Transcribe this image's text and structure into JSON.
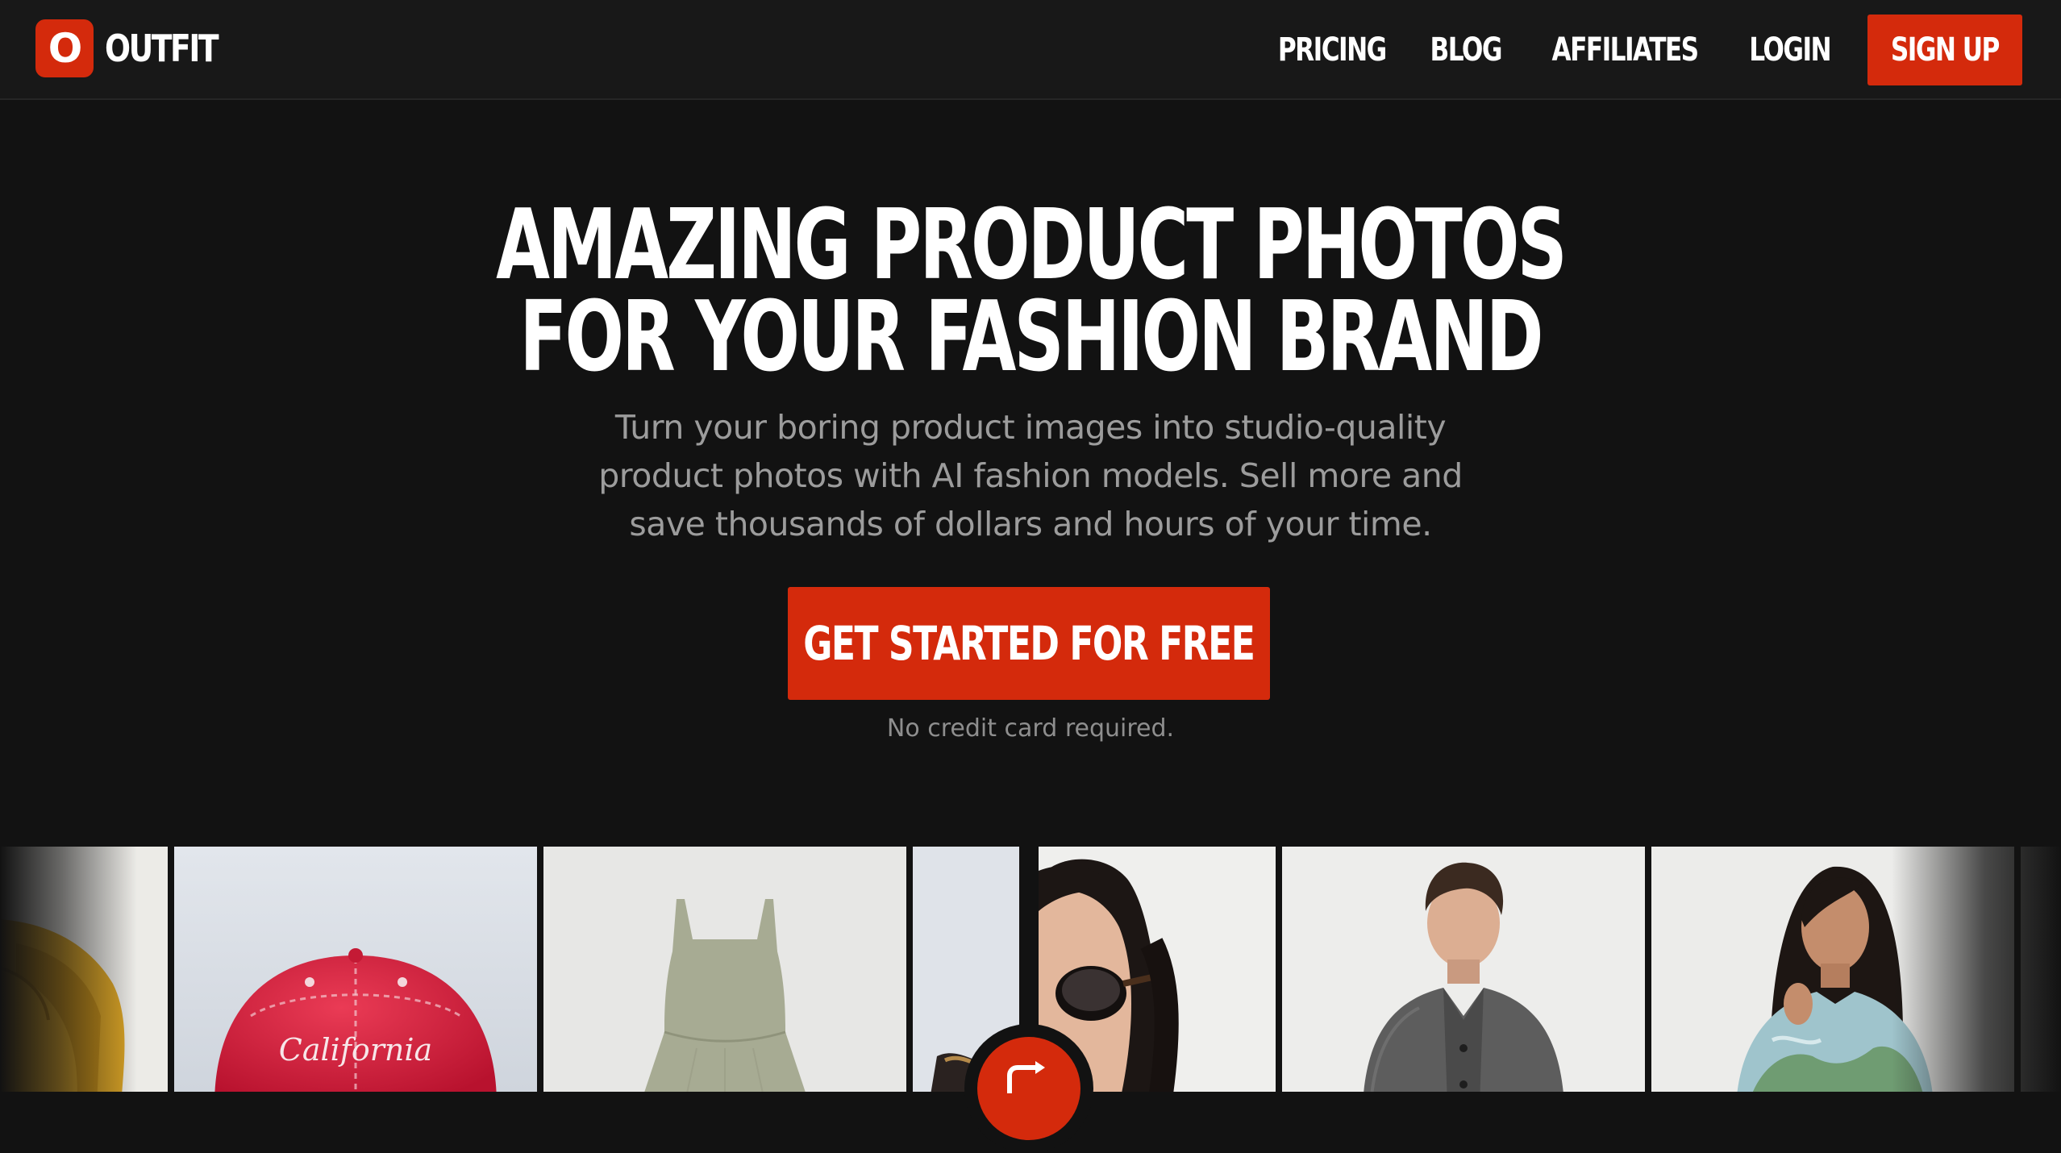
{
  "header": {
    "logo_mark": "O",
    "logo_text": "OUTFIT",
    "nav": [
      {
        "label": "PRICING"
      },
      {
        "label": "BLOG"
      },
      {
        "label": "AFFILIATES"
      },
      {
        "label": "LOGIN"
      }
    ],
    "signup_label": "SIGN UP"
  },
  "hero": {
    "title_line1": "AMAZING PRODUCT PHOTOS",
    "title_line2": "FOR YOUR FASHION BRAND",
    "subtitle_line1": "Turn your boring product images into studio-quality",
    "subtitle_line2": "product photos with AI fashion models. Sell more and",
    "subtitle_line3": "save thousands of dollars and hours of your time.",
    "cta_label": "GET STARTED FOR FREE",
    "note": "No credit card required."
  },
  "gallery": {
    "cap_text": "California",
    "images": [
      {
        "name": "yellow-jacket"
      },
      {
        "name": "red-california-cap"
      },
      {
        "name": "sage-dress"
      },
      {
        "name": "product-partial"
      },
      {
        "name": "model-sunglasses"
      },
      {
        "name": "model-man-tweed-jacket"
      },
      {
        "name": "model-woman-sweater"
      }
    ]
  },
  "colors": {
    "accent": "#d42a0c",
    "background": "#121212",
    "header_bg": "#181818",
    "subtitle": "#9c9c9c"
  },
  "icons": {
    "swap": "swap-arrow-icon"
  }
}
